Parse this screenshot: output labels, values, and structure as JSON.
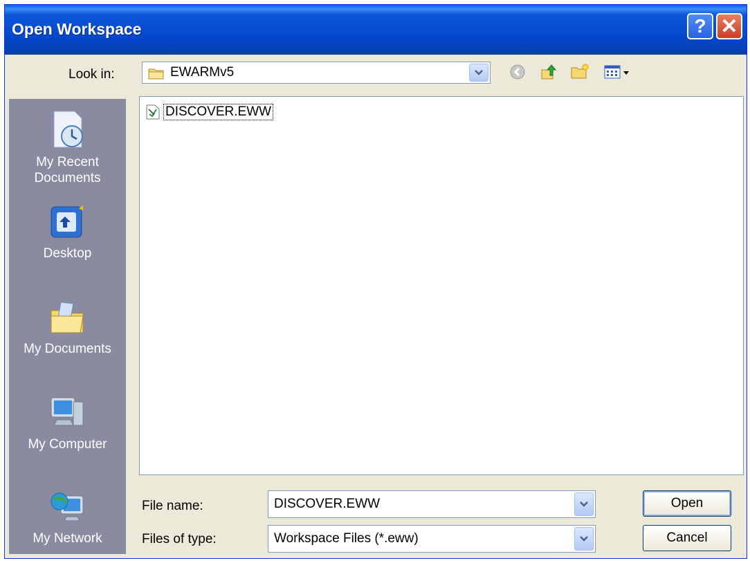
{
  "window": {
    "title": "Open Workspace",
    "help_label": "?",
    "close_label": "✕"
  },
  "lookin": {
    "label": "Look in:",
    "value": "EWARMv5"
  },
  "places": [
    {
      "line1": "My Recent",
      "line2": "Documents"
    },
    {
      "line1": "Desktop",
      "line2": ""
    },
    {
      "line1": "My Documents",
      "line2": ""
    },
    {
      "line1": "My Computer",
      "line2": ""
    },
    {
      "line1": "My Network",
      "line2": ""
    }
  ],
  "files": [
    {
      "name": "DISCOVER.EWW"
    }
  ],
  "filename": {
    "label": "File name:",
    "value": "DISCOVER.EWW"
  },
  "filetype": {
    "label": "Files of type:",
    "value": "Workspace Files (*.eww)"
  },
  "buttons": {
    "open": "Open",
    "cancel": "Cancel"
  },
  "colors": {
    "titlebar": "#0a57d8",
    "places_bg": "#8a8aa0",
    "dialog_bg": "#ece9d8"
  }
}
